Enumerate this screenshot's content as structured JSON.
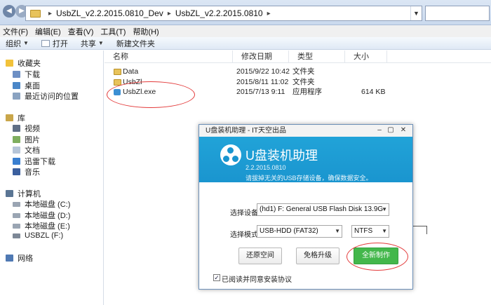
{
  "address": {
    "folder1": "UsbZL_v2.2.2015.0810_Dev",
    "folder2": "UsbZL_v2.2.2015.0810"
  },
  "menu": [
    "文件(F)",
    "编辑(E)",
    "查看(V)",
    "工具(T)",
    "帮助(H)"
  ],
  "toolbar": {
    "organize": "组织",
    "open": "打开",
    "share": "共享",
    "new_folder": "新建文件夹"
  },
  "nav": {
    "favorites": "收藏夹",
    "downloads": "下载",
    "desktop": "桌面",
    "recent": "最近访问的位置",
    "library": "库",
    "videos": "视频",
    "pictures": "图片",
    "documents": "文档",
    "thunder": "迅雷下载",
    "music": "音乐",
    "computer": "计算机",
    "disk_c": "本地磁盘 (C:)",
    "disk_d": "本地磁盘 (D:)",
    "disk_e": "本地磁盘 (E:)",
    "usbzl": "USBZL (F:)",
    "network": "网络"
  },
  "columns": {
    "name": "名称",
    "date": "修改日期",
    "type": "类型",
    "size": "大小"
  },
  "files": [
    {
      "name": "Data",
      "date": "2015/9/22 10:42",
      "type": "文件夹",
      "size": ""
    },
    {
      "name": "UsbZl",
      "date": "2015/8/11 11:02",
      "type": "文件夹",
      "size": ""
    },
    {
      "name": "UsbZl.exe",
      "date": "2015/7/13 9:11",
      "type": "应用程序",
      "size": "614 KB"
    }
  ],
  "dialog": {
    "window_title": "U盘装机助理 - IT天空出品",
    "title": "U盘装机助理",
    "version": "2.2.2015.0810",
    "note": "请拔掉无关的USB存储设备，确保数据安全。",
    "device_label": "选择设备",
    "device_value": "(hd1) F: General USB Flash Disk 13.9G",
    "mode_label": "选择模式",
    "mode_value": "USB-HDD (FAT32)",
    "fs_value": "NTFS",
    "restore_button": "还原空间",
    "upgrade_button": "免格升级",
    "make_button": "全新制作",
    "agree_text": "已阅读并同意安装协议"
  }
}
